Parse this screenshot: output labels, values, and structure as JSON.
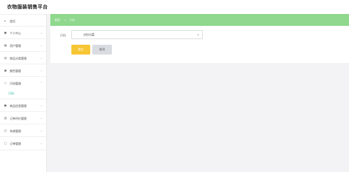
{
  "app": {
    "title": "衣物服装销售平台"
  },
  "sidebar": {
    "items": [
      {
        "label": "首页",
        "icon": "home-icon",
        "glyph": "⌂",
        "chevron": false
      },
      {
        "label": "个人中心",
        "icon": "user-icon",
        "glyph": "●",
        "chevron": true
      },
      {
        "label": "用户管理",
        "icon": "grid-icon",
        "glyph": "▦",
        "chevron": true
      },
      {
        "label": "商品分类管理",
        "icon": "list-icon",
        "glyph": "▤",
        "chevron": true
      },
      {
        "label": "颜色管理",
        "icon": "palette-icon",
        "glyph": "▣",
        "chevron": true
      },
      {
        "label": "尺码管理",
        "icon": "circle-icon",
        "glyph": "○",
        "chevron": true
      },
      {
        "label": "商品信息管理",
        "icon": "person-icon",
        "glyph": "●",
        "chevron": true
      },
      {
        "label": "订单评价管理",
        "icon": "chart-icon",
        "glyph": "▥",
        "chevron": true
      },
      {
        "label": "系统管理",
        "icon": "settings-icon",
        "glyph": "◫",
        "chevron": true
      },
      {
        "label": "订单管理",
        "icon": "order-icon",
        "glyph": "▢",
        "chevron": true
      }
    ],
    "sub_item": "尺码"
  },
  "breadcrumb": {
    "home": "首页",
    "sep": "→",
    "current": "尺码"
  },
  "form": {
    "size_label": "尺码",
    "size_value": "沙拉与菜",
    "clear_glyph": "⊗"
  },
  "buttons": {
    "confirm": "提交",
    "cancel": "取消"
  },
  "colors": {
    "breadcrumb_bg": "#8fd88d",
    "confirm_bg": "#f7c634",
    "cancel_bg": "#d9dce1",
    "active_sub": "#20b7a4"
  }
}
